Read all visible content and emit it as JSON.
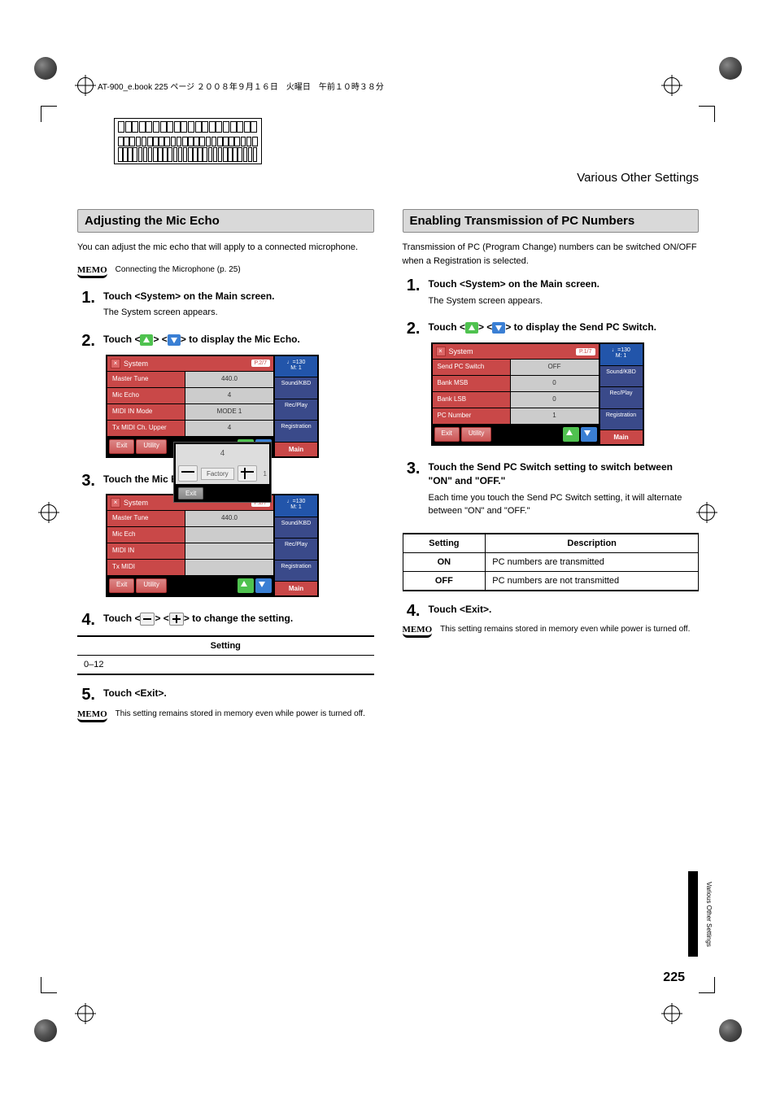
{
  "print_header": "AT-900_e.book  225 ページ  ２００８年９月１６日　火曜日　午前１０時３８分",
  "section_title": "Various Other Settings",
  "side_tab_text": "Various Other Settings",
  "page_number": "225",
  "left": {
    "heading": "Adjusting the Mic Echo",
    "intro": "You can adjust the mic echo that will apply to a connected microphone.",
    "memo1": "Connecting the Microphone (p. 25)",
    "steps": {
      "s1": {
        "title": "Touch <System> on the Main screen.",
        "sub": "The System screen appears."
      },
      "s2": {
        "title_pre": "Touch <",
        "title_mid": "> <",
        "title_post": "> to display the Mic Echo."
      },
      "s3": {
        "title": "Touch the Mic Echo setting."
      },
      "s4": {
        "title_pre": "Touch <",
        "title_mid": "> <",
        "title_post": "> to change the setting."
      },
      "s5": {
        "title": "Touch <Exit>."
      }
    },
    "screen1": {
      "title": "System",
      "page": "P.2/7",
      "tempo": "♩=130",
      "m": "M:   1",
      "rows": [
        {
          "l": "Master Tune",
          "r": "440.0"
        },
        {
          "l": "Mic Echo",
          "r": "4"
        },
        {
          "l": "MIDI IN Mode",
          "r": "MODE 1"
        },
        {
          "l": "Tx MIDI Ch. Upper",
          "r": "4"
        }
      ],
      "exit": "Exit",
      "utility": "Utility",
      "side": [
        "Sound/KBD",
        "Rec/Play",
        "Registration"
      ],
      "main": "Main"
    },
    "screen2": {
      "title": "System",
      "page": "P.2/7",
      "tempo": "♩=130",
      "m": "M:   1",
      "popup_val": "4",
      "factory": "Factory",
      "popup_r": "1",
      "rows": [
        {
          "l": "Master Tune",
          "r": "440.0"
        },
        {
          "l": "Mic Ech",
          "r": ""
        },
        {
          "l": "MIDI IN",
          "r": ""
        },
        {
          "l": "Tx MIDI",
          "r": ""
        }
      ],
      "exit": "Exit",
      "utility": "Utility",
      "pop_exit": "Exit",
      "side": [
        "Sound/KBD",
        "Rec/Play",
        "Registration"
      ],
      "main": "Main"
    },
    "table": {
      "header": "Setting",
      "value": "0–12"
    },
    "memo2": "This setting remains stored in memory even while power is turned off."
  },
  "right": {
    "heading": "Enabling Transmission of PC Numbers",
    "intro": "Transmission of PC (Program Change) numbers can be switched ON/OFF when a Registration is selected.",
    "steps": {
      "s1": {
        "title": "Touch <System> on the Main screen.",
        "sub": "The System screen appears."
      },
      "s2": {
        "title_pre": "Touch <",
        "title_mid": "> <",
        "title_post": "> to display the Send PC Switch."
      },
      "s3": {
        "title": "Touch the Send PC Switch setting to switch between \"ON\" and \"OFF.\"",
        "sub": "Each time you touch the Send PC Switch setting, it will alternate between \"ON\" and \"OFF.\""
      },
      "s4": {
        "title": "Touch <Exit>."
      }
    },
    "screen": {
      "title": "System",
      "page": "P.1/7",
      "tempo": "♩=130",
      "m": "M:   1",
      "rows": [
        {
          "l": "Send PC Switch",
          "r": "OFF"
        },
        {
          "l": "Bank MSB",
          "r": "0"
        },
        {
          "l": "Bank LSB",
          "r": "0"
        },
        {
          "l": "PC Number",
          "r": "1"
        }
      ],
      "exit": "Exit",
      "utility": "Utility",
      "side": [
        "Sound/KBD",
        "Rec/Play",
        "Registration"
      ],
      "main": "Main"
    },
    "table": {
      "h1": "Setting",
      "h2": "Description",
      "r1c1": "ON",
      "r1c2": "PC numbers are transmitted",
      "r2c1": "OFF",
      "r2c2": "PC numbers are not transmitted"
    },
    "memo": "This setting remains stored in memory even while power is turned off."
  },
  "memo_label": "MEMO"
}
